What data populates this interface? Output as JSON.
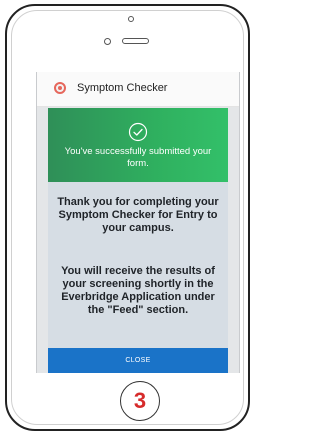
{
  "app": {
    "title": "Symptom Checker"
  },
  "success_banner": {
    "message": "You've successfully submitted your form.",
    "icon": "check-circle-icon"
  },
  "body": {
    "thanks_message": "Thank you for completing your Symptom Checker for Entry to your campus.",
    "results_message": "You will receive the results of your screening shortly in the Everbridge Application under the \"Feed\" section."
  },
  "actions": {
    "close_label": "CLOSE"
  },
  "step_marker": "3",
  "colors": {
    "success_green": "#2fb05f",
    "button_blue": "#1a73c8",
    "step_red": "#d62b2b",
    "logo_red": "#e6675c"
  }
}
